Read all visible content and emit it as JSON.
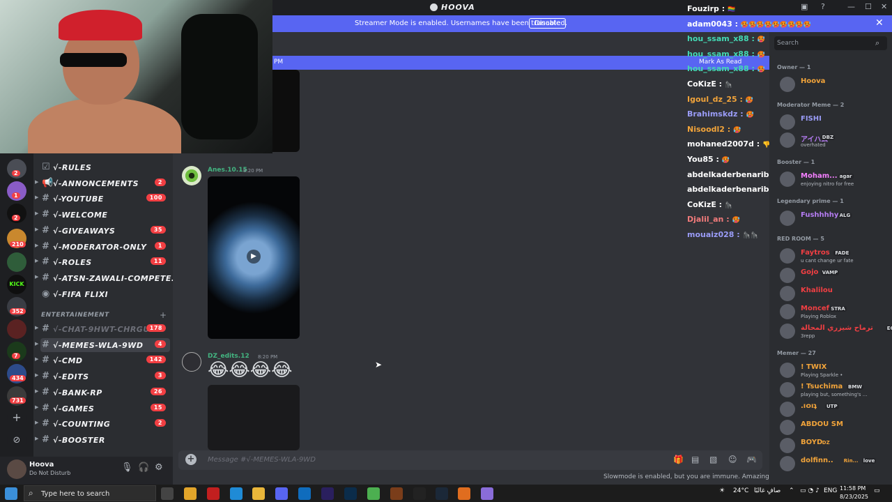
{
  "titlebar": {
    "title": "HOOVA"
  },
  "banner": {
    "message": "Streamer Mode is enabled. Usernames have been truncated.",
    "disable_label": "Disable"
  },
  "new_messages": {
    "time_fragment": "PM",
    "mark_as_read": "Mark As Read"
  },
  "channels": {
    "items": [
      {
        "name": "√-RULES",
        "badge": "",
        "icon": "rules"
      },
      {
        "name": "√-ANNONCEMENTS",
        "badge": "2",
        "icon": "megaphone"
      },
      {
        "name": "√-YOUTUBE",
        "badge": "100",
        "icon": "hash"
      },
      {
        "name": "√-WELCOME",
        "badge": "",
        "icon": "hash"
      },
      {
        "name": "√-GIVEAWAYS",
        "badge": "35",
        "icon": "hash"
      },
      {
        "name": "√-MODERATOR-ONLY",
        "badge": "1",
        "icon": "hash"
      },
      {
        "name": "√-ROLES",
        "badge": "11",
        "icon": "hash"
      },
      {
        "name": "√-ATSN-ZAWALI-COMPETE...",
        "badge": "",
        "icon": "hash"
      },
      {
        "name": "√-FIFA FLIXI",
        "badge": "",
        "icon": "voice"
      }
    ],
    "category": "ENTERTAINEMENT",
    "items2": [
      {
        "name": "√-CHAT-9HWT-CHRGUI",
        "badge": "178",
        "muted": true
      },
      {
        "name": "√-MEMES-WLA-9WD",
        "badge": "4",
        "active": true
      },
      {
        "name": "√-CMD",
        "badge": "142"
      },
      {
        "name": "√-EDITS",
        "badge": "3"
      },
      {
        "name": "√-BANK-RP",
        "badge": "26"
      },
      {
        "name": "√-GAMES",
        "badge": "15"
      },
      {
        "name": "√-COUNTING",
        "badge": "2"
      },
      {
        "name": "√-BOOSTER",
        "badge": ""
      }
    ]
  },
  "servers": {
    "badges": [
      "2",
      "1",
      "2",
      "210",
      "352",
      "7",
      "434",
      "731"
    ],
    "kick_label": "KICK"
  },
  "user": {
    "name": "Hoova",
    "status": "Do Not Disturb"
  },
  "messages": [
    {
      "author": "Anes.10.15",
      "time": "8:20 PM",
      "color": "#43b581"
    },
    {
      "author": "DZ_edits.12",
      "time": "8:20 PM",
      "color": "#43b581",
      "emojis": "😂😂😂😂"
    }
  ],
  "composer": {
    "placeholder": "Message #√-MEMES-WLA-9WD"
  },
  "slowmode": "Slowmode is enabled, but you are immune. Amazing!",
  "stream_chat": [
    {
      "user": "Fouzirp",
      "color": "#ffffff",
      "tail": "🏳️‍🌈"
    },
    {
      "user": "adam0043",
      "color": "#ffffff",
      "tail": "🥵🥵🥵🥵🥵🥵🥵🥵🥵"
    },
    {
      "user": "hou_ssam_x88",
      "color": "#43d9b4",
      "tail": "🥵"
    },
    {
      "user": "hou_ssam_x88",
      "color": "#43d9b4",
      "tail": "🥵"
    },
    {
      "user": "hou_ssam_x88",
      "color": "#43d9b4",
      "tail": "🥵"
    },
    {
      "user": "CoKizE",
      "color": "#ffffff",
      "tail": "🦍"
    },
    {
      "user": "Igoul_dz_25",
      "color": "#f2a43a",
      "tail": "🥵"
    },
    {
      "user": "Brahimskdz",
      "color": "#9a9cf7",
      "tail": "🥵"
    },
    {
      "user": "Nisoodl2",
      "color": "#f2a43a",
      "tail": "🥵"
    },
    {
      "user": "mohaned2007d",
      "color": "#ffffff",
      "tail": "👎"
    },
    {
      "user": "You85",
      "color": "#ffffff",
      "tail": "🥵"
    },
    {
      "user": "abdelkaderbenaribi",
      "color": "#ffffff",
      "tail": "🥵"
    },
    {
      "user": "abdelkaderbenaribi",
      "color": "#ffffff",
      "tail": "🥵"
    },
    {
      "user": "CoKizE",
      "color": "#ffffff",
      "tail": "🦍"
    },
    {
      "user": "Djalil_an",
      "color": "#f27b7b",
      "tail": "🥵"
    },
    {
      "user": "mouaiz028",
      "color": "#9a9cf7",
      "tail": "🦍🦍"
    }
  ],
  "members": {
    "search_placeholder": "Search",
    "groups": [
      {
        "label": "Owner — 1",
        "members": [
          {
            "name": "Hoova",
            "color": "#f2a43a"
          }
        ]
      },
      {
        "label": "Moderator Meme — 2",
        "members": [
          {
            "name": "FISHI",
            "color": "#9a9cf7"
          },
          {
            "name": "アイハム",
            "color": "#b57cf2",
            "tag": "DBZ",
            "status": "overhated"
          }
        ]
      },
      {
        "label": "Booster — 1",
        "members": [
          {
            "name": "Moham...",
            "color": "#f47fff",
            "tag": "agar",
            "status": "enjoying nitro for free"
          }
        ]
      },
      {
        "label": "Legendary prime — 1",
        "members": [
          {
            "name": "Fushhhhy",
            "color": "#b57cf2",
            "tag": "ALG"
          }
        ]
      },
      {
        "label": "RED ROOM — 5",
        "members": [
          {
            "name": "Faytros",
            "color": "#f23f43",
            "tag": "FADE",
            "status": "u cant change ur fate"
          },
          {
            "name": "Gojo",
            "color": "#f23f43",
            "tag": "VAMP"
          },
          {
            "name": "Khalilou",
            "color": "#f23f43"
          },
          {
            "name": "Moncef",
            "color": "#f23f43",
            "tag": "STRA",
            "status": "Playing Roblox"
          },
          {
            "name": "ترماح شيزري المحالة",
            "color": "#f23f43",
            "tag": "EGO",
            "status": "3repp"
          }
        ]
      },
      {
        "label": "Memer — 27",
        "members": [
          {
            "name": "! TWIX",
            "color": "#f2a43a",
            "status": "Playing Sparkle •"
          },
          {
            "name": "! Tsuchima",
            "color": "#f2a43a",
            "tag": "BMW",
            "status": "playing but, something's ..."
          },
          {
            "name": ".ı໐ıʇ",
            "color": "#f2a43a",
            "tag": "UTP"
          },
          {
            "name": "ABDOU SM",
            "color": "#f2a43a"
          },
          {
            "name": "BOYD",
            "color": "#f2a43a",
            "suffix": "DZ"
          },
          {
            "name": "dolfinn..",
            "color": "#f2a43a",
            "tag": "love",
            "extra": "Rin..."
          }
        ]
      }
    ]
  },
  "taskbar": {
    "search_placeholder": "Type here to search",
    "weather": "24°C",
    "weather_text": "صافٍ غالبًا",
    "lang": "ENG",
    "time": "11:58 PM",
    "date": "8/23/2025"
  },
  "colors": {
    "blurple": "#5865f2",
    "bg": "#313338",
    "sidebar": "#2b2d31",
    "dark": "#1e1f22"
  }
}
